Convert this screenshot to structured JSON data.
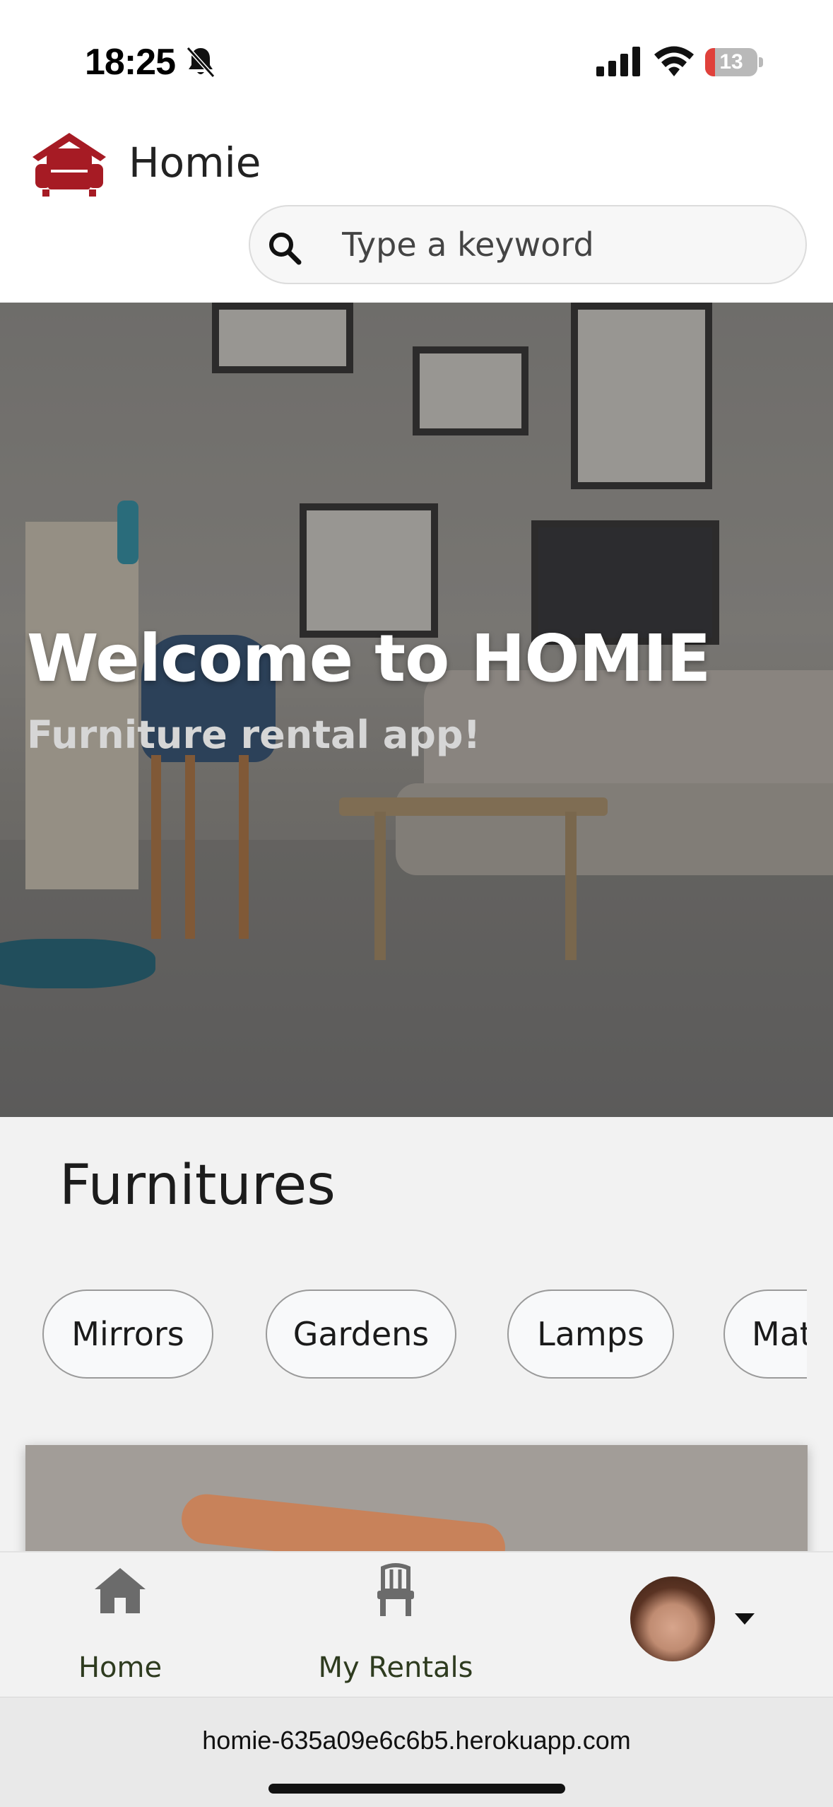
{
  "status_bar": {
    "time": "18:25",
    "battery": "13",
    "battery_level_percent": 13,
    "icons": [
      "bell-slash-icon",
      "cellular-signal-icon",
      "wifi-icon",
      "battery-icon"
    ]
  },
  "header": {
    "brand": "Homie",
    "logo_icon": "armchair-house-icon",
    "brand_color": "#a61b24",
    "search": {
      "placeholder": "Type a keyword",
      "icon": "search-icon"
    }
  },
  "hero": {
    "title": "Welcome to HOMIE",
    "subtitle": "Furniture rental app!"
  },
  "furnitures": {
    "title": "Furnitures",
    "categories": [
      "Mirrors",
      "Gardens",
      "Lamps",
      "Mat"
    ]
  },
  "bottom_nav": {
    "items": [
      {
        "label": "Home",
        "icon": "home-icon"
      },
      {
        "label": "My Rentals",
        "icon": "chair-icon"
      }
    ],
    "profile": {
      "icon": "avatar",
      "menu_icon": "caret-down-icon"
    }
  },
  "browser": {
    "url": "homie-635a09e6c6b5.herokuapp.com"
  }
}
